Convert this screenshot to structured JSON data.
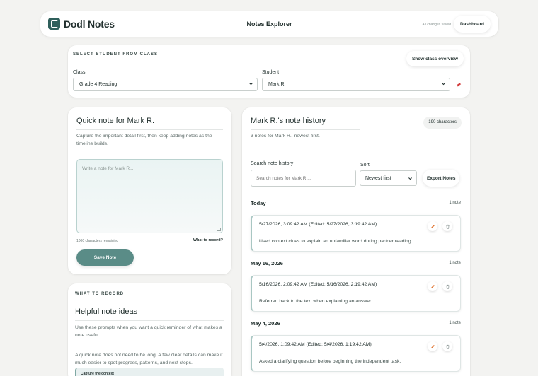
{
  "header": {
    "app_name": "Dodl Notes",
    "page_title": "Notes Explorer",
    "save_status": "All changes saved",
    "dashboard_label": "Dashboard"
  },
  "student_select": {
    "section_label": "SELECT STUDENT FROM CLASS",
    "overview_label": "Show class overview",
    "class_label": "Class",
    "class_value": "Grade 4 Reading",
    "student_label": "Student",
    "student_value": "Mark R."
  },
  "quick_note": {
    "title": "Quick note for Mark R.",
    "description": "Capture the important detail first, then keep adding notes as the timeline builds.",
    "placeholder": "Write a note for Mark R....",
    "remaining": "1000 characters remaining",
    "what_to_record_link": "What to record?",
    "save_label": "Save Note"
  },
  "ideas": {
    "section_label": "WHAT TO RECORD",
    "title": "Helpful note ideas",
    "p1": "Use these prompts when you want a quick reminder of what makes a note useful.",
    "p2": "A quick note does not need to be long. A few clear details can make it much easier to spot progress, patterns, and next steps.",
    "tip_title": "Capture the context"
  },
  "history": {
    "title": "Mark R.'s note history",
    "char_badge": "190 characters",
    "description": "3 notes for Mark R., newest first.",
    "search_label": "Search note history",
    "search_placeholder": "Search notes for Mark R....",
    "sort_label": "Sort",
    "sort_value": "Newest first",
    "export_label": "Export Notes",
    "groups": [
      {
        "title": "Today",
        "count": "1 note",
        "stamp": "5/27/2026, 3:09:42 AM (Edited: 5/27/2026, 3:19:42 AM)",
        "text": "Used context clues to explain an unfamiliar word during partner reading."
      },
      {
        "title": "May 16, 2026",
        "count": "1 note",
        "stamp": "5/16/2026, 2:09:42 AM (Edited: 5/16/2026, 2:19:42 AM)",
        "text": "Referred back to the text when explaining an answer."
      },
      {
        "title": "May 4, 2026",
        "count": "1 note",
        "stamp": "5/4/2026, 1:09:42 AM (Edited: 5/4/2026, 1:19:42 AM)",
        "text": "Asked a clarifying question before beginning the independent task."
      }
    ]
  },
  "icons": {
    "logo": "notebook-logo-icon",
    "pin": "pin-icon",
    "edit": "pencil-icon",
    "delete": "trash-icon",
    "dropdown": "chevron-down-icon"
  },
  "colors": {
    "brand": "#2f5f5b",
    "save_button": "#5a8c87",
    "edit_icon": "#e07a3a",
    "pin": "#d23a3a",
    "background": "#f3f3f1"
  }
}
